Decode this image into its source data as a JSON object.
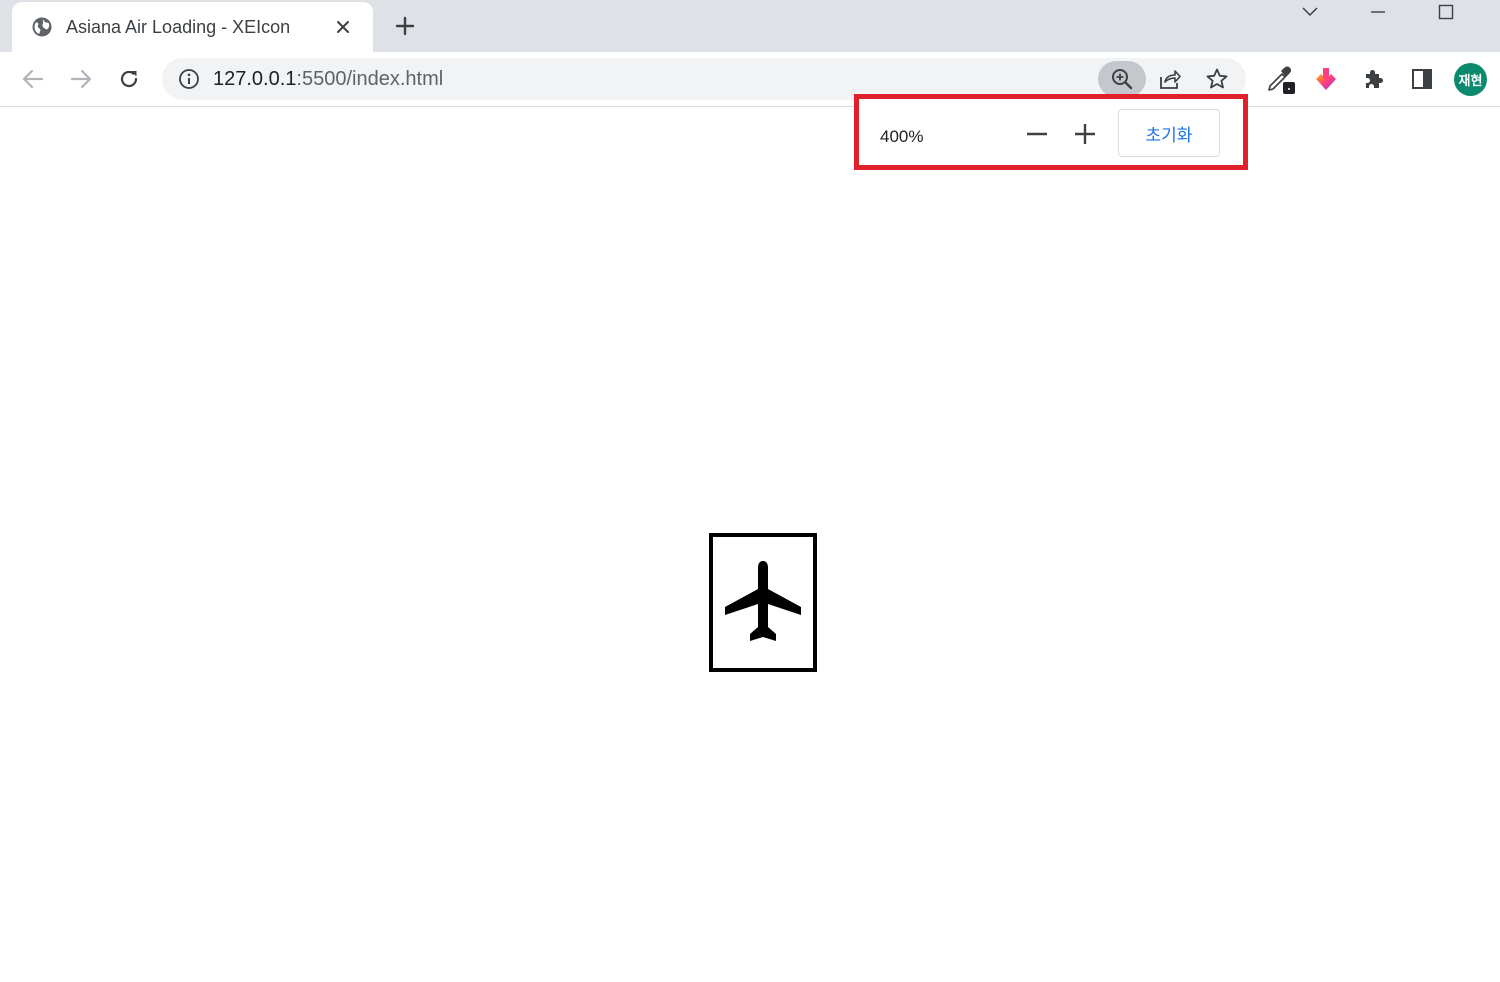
{
  "tab": {
    "title": "Asiana Air Loading - XEIcon",
    "favicon": "globe-icon"
  },
  "toolbar": {
    "url_host": "127.0.0.1",
    "url_path": ":5500/index.html"
  },
  "profile": {
    "avatar_text": "재현",
    "color": "#0b8a6e"
  },
  "zoom": {
    "level": "400%",
    "reset_label": "초기화",
    "highlight_color": "#e0202a"
  },
  "page": {
    "icon": "airplane-icon"
  }
}
